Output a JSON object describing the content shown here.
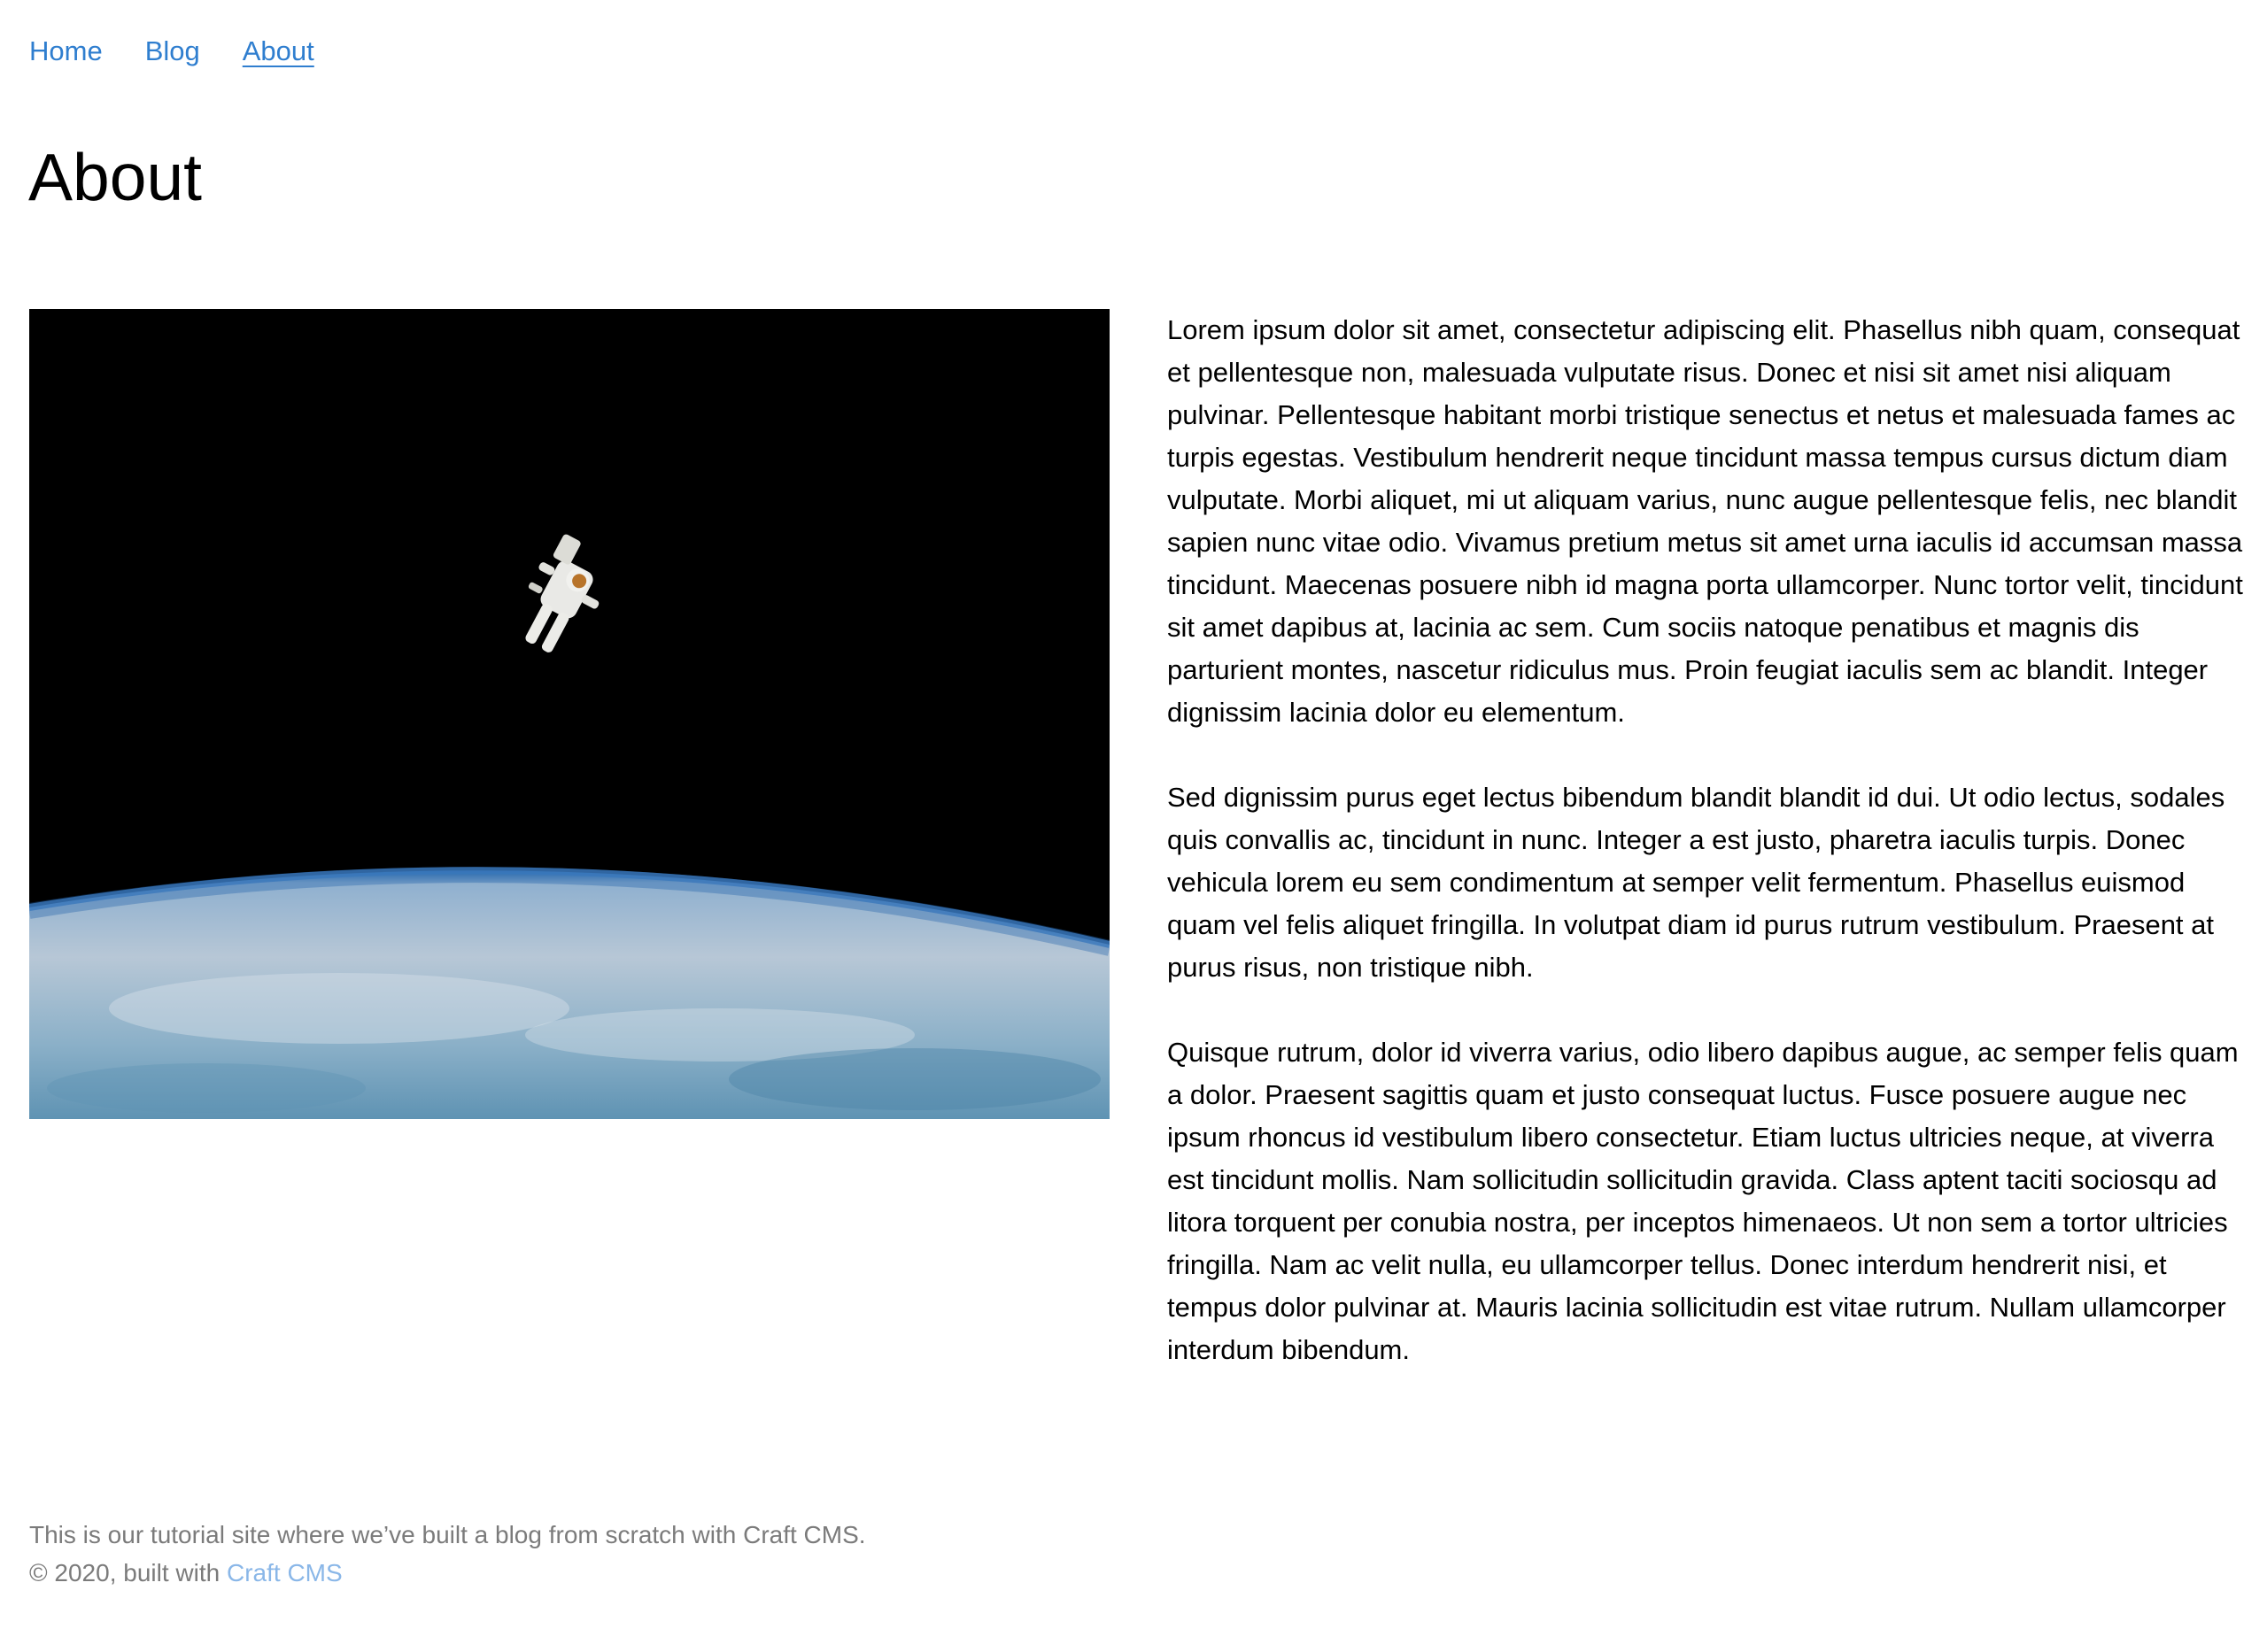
{
  "nav": {
    "items": [
      {
        "label": "Home"
      },
      {
        "label": "Blog"
      },
      {
        "label": "About"
      }
    ],
    "active": "About"
  },
  "page": {
    "title": "About"
  },
  "hero_image": {
    "subject": "astronaut floating above Earth",
    "icon": "astronaut-image"
  },
  "content": {
    "paragraphs": [
      "Lorem ipsum dolor sit amet, consectetur adipiscing elit. Phasellus nibh quam, consequat et pellentesque non, malesuada vulputate risus. Donec et nisi sit amet nisi aliquam pulvinar. Pellentesque habitant morbi tristique senectus et netus et malesuada fames ac turpis egestas. Vestibulum hendrerit neque tincidunt massa tempus cursus dictum diam vulputate. Morbi aliquet, mi ut aliquam varius, nunc augue pellentesque felis, nec blandit sapien nunc vitae odio. Vivamus pretium metus sit amet urna iaculis id accumsan massa tincidunt. Maecenas posuere nibh id magna porta ullamcorper. Nunc tortor velit, tincidunt sit amet dapibus at, lacinia ac sem. Cum sociis natoque penatibus et magnis dis parturient montes, nascetur ridiculus mus. Proin feugiat iaculis sem ac blandit. Integer dignissim lacinia dolor eu elementum.",
      "Sed dignissim purus eget lectus bibendum blandit blandit id dui. Ut odio lectus, sodales quis convallis ac, tincidunt in nunc. Integer a est justo, pharetra iaculis turpis. Donec vehicula lorem eu sem condimentum at semper velit fermentum. Phasellus euismod quam vel felis aliquet fringilla. In volutpat diam id purus rutrum vestibulum. Praesent at purus risus, non tristique nibh.",
      "Quisque rutrum, dolor id viverra varius, odio libero dapibus augue, ac semper felis quam a dolor. Praesent sagittis quam et justo consequat luctus. Fusce posuere augue nec ipsum rhoncus id vestibulum libero consectetur. Etiam luctus ultricies neque, at viverra est tincidunt mollis. Nam sollicitudin sollicitudin gravida. Class aptent taciti sociosqu ad litora torquent per conubia nostra, per inceptos himenaeos. Ut non sem a tortor ultricies fringilla. Nam ac velit nulla, eu ullamcorper tellus. Donec interdum hendrerit nisi, et tempus dolor pulvinar at. Mauris lacinia sollicitudin est vitae rutrum. Nullam ullamcorper interdum bibendum."
    ]
  },
  "footer": {
    "tagline": "This is our tutorial site where we’ve built a blog from scratch with Craft CMS.",
    "copyright_prefix": "© 2020, built with ",
    "link_label": "Craft CMS"
  },
  "colors": {
    "link": "#2f7ecf",
    "footer_text": "#7b7b7b",
    "footer_link": "#8ab7e8",
    "text": "#000000",
    "background": "#ffffff"
  }
}
